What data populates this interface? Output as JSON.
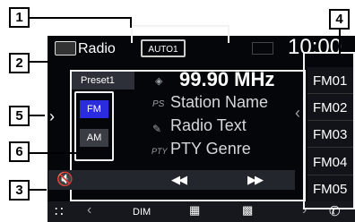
{
  "header": {
    "source_title": "Radio",
    "preset_mode": "AUTO1",
    "clock": "10:00"
  },
  "station": {
    "preset": "Preset1",
    "frequency": "99.90 MHz",
    "ps_label": "PS",
    "station_name": "Station Name",
    "radio_text": "Radio Text",
    "pty_label": "PTY",
    "pty_genre": "PTY Genre"
  },
  "bands": [
    "FM",
    "AM"
  ],
  "presets": [
    "FM01",
    "FM02",
    "FM03",
    "FM04",
    "FM05"
  ],
  "bottom_bar": {
    "dim": "DIM"
  },
  "callouts": [
    "1",
    "2",
    "3",
    "4",
    "5",
    "6"
  ],
  "colors": {
    "selected_band": "#2b2be0",
    "preset_bg": "#111318",
    "accent_lines": "#f3f3f3"
  }
}
